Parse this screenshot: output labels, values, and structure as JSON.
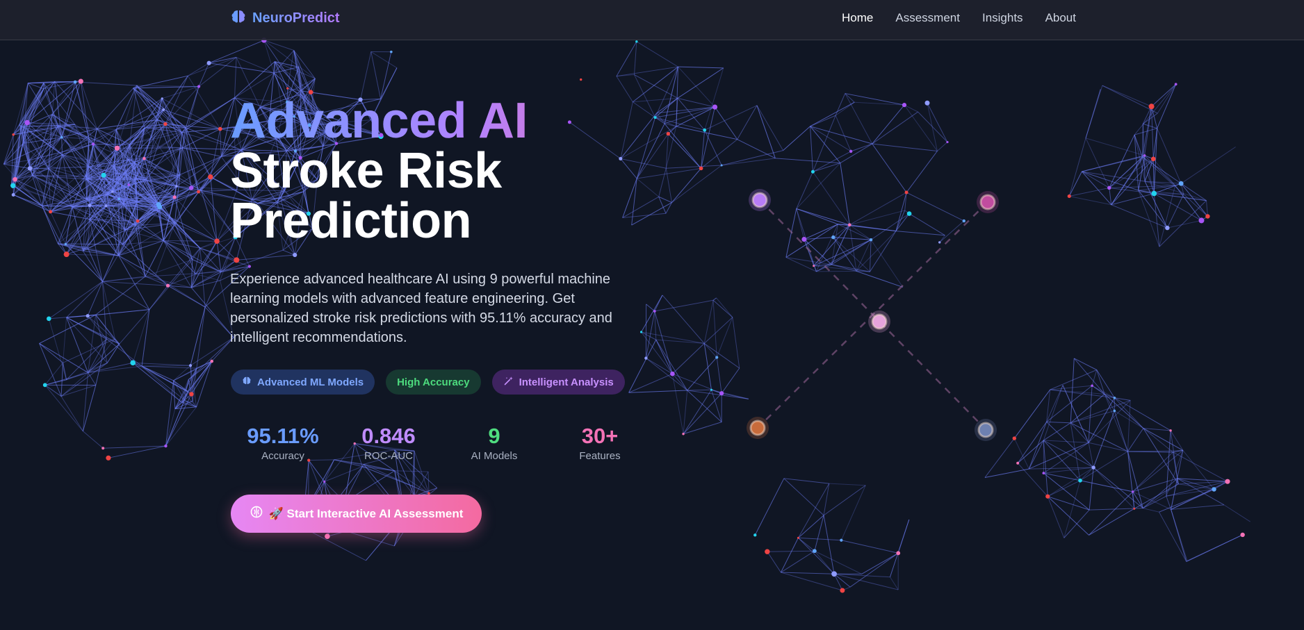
{
  "nav": {
    "brand": "NeuroPredict",
    "links": [
      "Home",
      "Assessment",
      "Insights",
      "About"
    ],
    "active": "Home"
  },
  "hero": {
    "title_gradient": "Advanced AI",
    "title_line2": "Stroke Risk",
    "title_line3": "Prediction",
    "description": "Experience advanced healthcare AI using 9 powerful machine learning models with advanced feature engineering. Get personalized stroke risk predictions with 95.11% accuracy and intelligent recommendations."
  },
  "badges": [
    "Advanced ML Models",
    "High Accuracy",
    "Intelligent Analysis"
  ],
  "stats": [
    {
      "value": "95.11%",
      "label": "Accuracy"
    },
    {
      "value": "0.846",
      "label": "ROC-AUC"
    },
    {
      "value": "9",
      "label": "AI Models"
    },
    {
      "value": "30+",
      "label": "Features"
    }
  ],
  "cta": {
    "label": "🚀 Start Interactive AI Assessment"
  },
  "colors": {
    "background": "#101624",
    "accent_blue": "#6a9cff",
    "accent_purple": "#c08cff",
    "accent_green": "#4fdc7f",
    "accent_pink": "#f472b6"
  },
  "icons": [
    "brain-icon",
    "star-icon",
    "magic-wand-icon",
    "rocket-icon"
  ]
}
